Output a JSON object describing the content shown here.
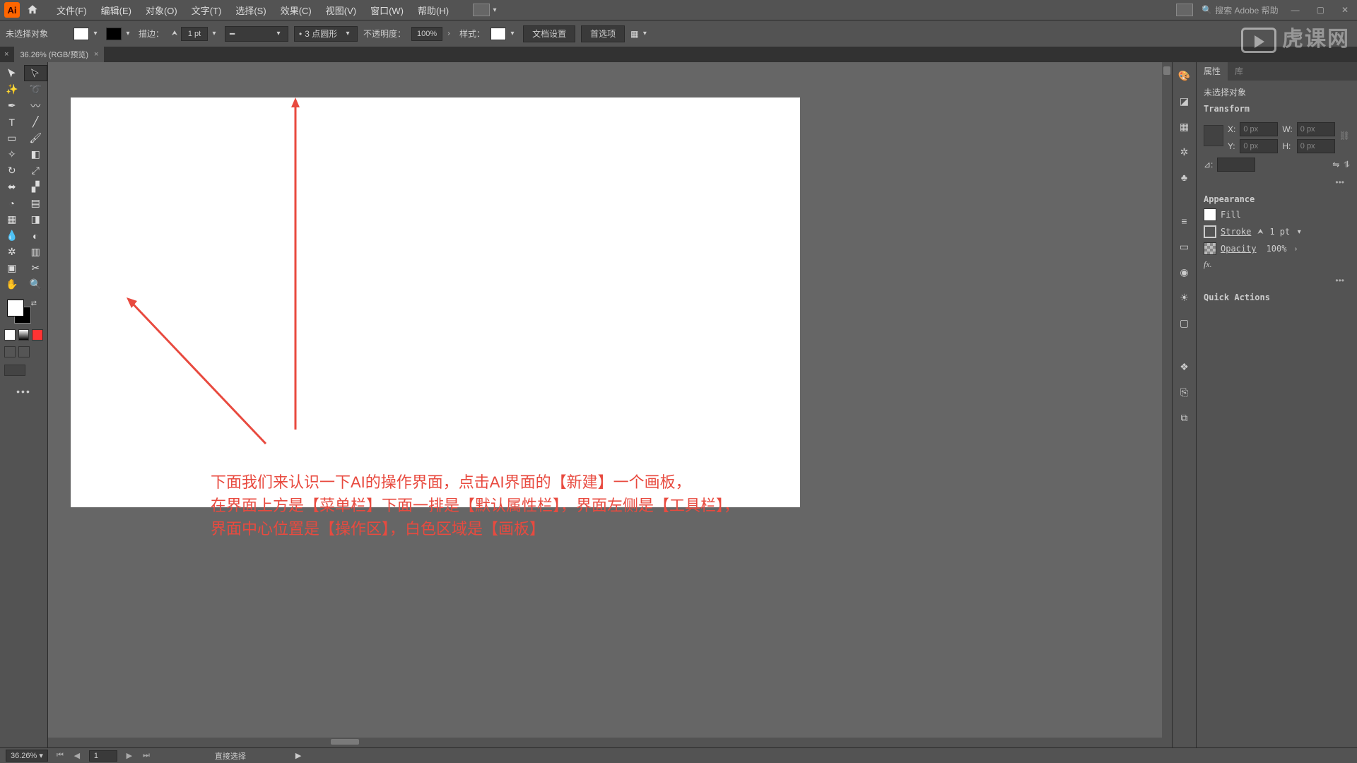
{
  "menubar": {
    "items": [
      "文件(F)",
      "编辑(E)",
      "对象(O)",
      "文字(T)",
      "选择(S)",
      "效果(C)",
      "视图(V)",
      "窗口(W)",
      "帮助(H)"
    ],
    "search_placeholder": "搜索 Adobe 帮助"
  },
  "options": {
    "no_selection": "未选择对象",
    "stroke_label": "描边：",
    "stroke_value": "1 pt",
    "brush_value": "3 点圆形",
    "opacity_label": "不透明度：",
    "opacity_value": "100%",
    "style_label": "样式：",
    "doc_setup": "文档设置",
    "prefs": "首选项"
  },
  "tab": {
    "title": "36.26% (RGB/预览)"
  },
  "annotation": {
    "line1": "下面我们来认识一下AI的操作界面，点击AI界面的【新建】一个画板，",
    "line2": "在界面上方是【菜单栏】下面一排是【默认属性栏】，界面左侧是【工具栏】，",
    "line3": "界面中心位置是【操作区】，白色区域是【画板】"
  },
  "panels": {
    "tabs": {
      "properties": "属性",
      "library": "库"
    },
    "no_selection": "未选择对象",
    "transform": {
      "title": "Transform",
      "x": "X:",
      "y": "Y:",
      "w": "W:",
      "h": "H:",
      "xval": "0 px",
      "yval": "0 px",
      "wval": "0 px",
      "hval": "0 px",
      "angle": "⊿:"
    },
    "appearance": {
      "title": "Appearance",
      "fill": "Fill",
      "stroke": "Stroke",
      "stroke_val": "1 pt",
      "opacity": "Opacity",
      "opacity_val": "100%",
      "fx": "fx."
    },
    "quick_actions": "Quick Actions"
  },
  "status": {
    "zoom": "36.26%",
    "artboard_num": "1",
    "tool": "直接选择"
  },
  "watermark": "虎课网"
}
